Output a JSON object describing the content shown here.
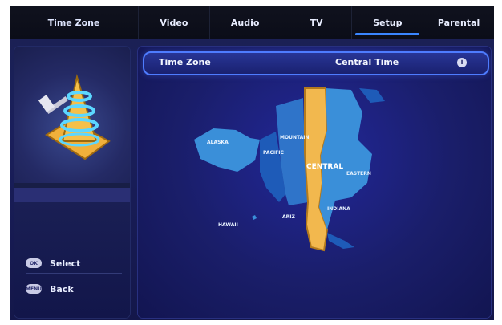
{
  "header": {
    "breadcrumb": "Time Zone"
  },
  "tabs": [
    {
      "label": "Video",
      "active": false
    },
    {
      "label": "Audio",
      "active": false
    },
    {
      "label": "TV",
      "active": false
    },
    {
      "label": "Setup",
      "active": true
    },
    {
      "label": "Parental",
      "active": false
    }
  ],
  "setting": {
    "label": "Time Zone",
    "value": "Central Time"
  },
  "map": {
    "zones": [
      "HAWAII",
      "ALASKA",
      "PACIFIC",
      "MOUNTAIN",
      "ARIZ",
      "CENTRAL",
      "EASTERN",
      "INDIANA"
    ],
    "highlight": "CENTRAL",
    "colors": {
      "highlight": "#f2b84e",
      "zone_a": "#3a8fd9",
      "zone_b": "#1e5bb8"
    }
  },
  "hints": [
    {
      "button": "OK",
      "label": "Select"
    },
    {
      "button": "MENU",
      "label": "Back"
    }
  ],
  "icons": [
    "setup-icon",
    "info-icon",
    "select-button-icon",
    "menu-button-icon"
  ]
}
